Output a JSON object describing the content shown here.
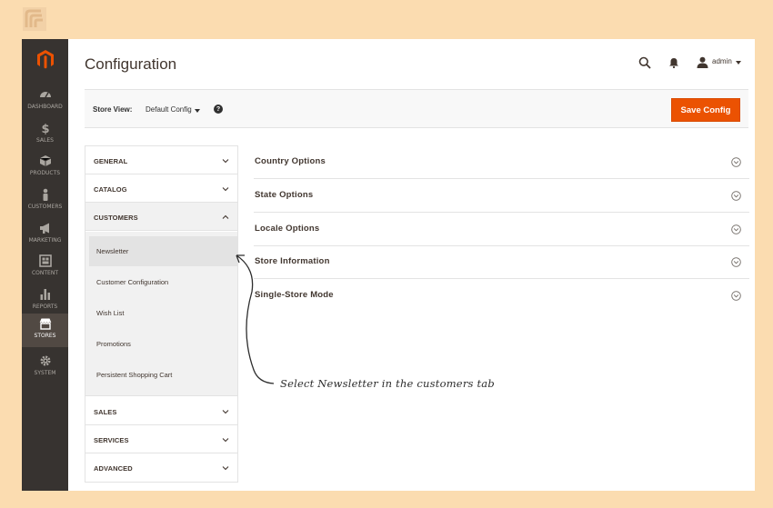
{
  "header": {
    "title": "Configuration",
    "user_name": "admin"
  },
  "nav": {
    "items": [
      {
        "label": "DASHBOARD",
        "icon": "dashboard-icon",
        "active": false
      },
      {
        "label": "SALES",
        "icon": "dollar-icon",
        "active": false
      },
      {
        "label": "PRODUCTS",
        "icon": "cube-icon",
        "active": false
      },
      {
        "label": "CUSTOMERS",
        "icon": "person-icon",
        "active": false
      },
      {
        "label": "MARKETING",
        "icon": "megaphone-icon",
        "active": false
      },
      {
        "label": "CONTENT",
        "icon": "content-icon",
        "active": false
      },
      {
        "label": "REPORTS",
        "icon": "bar-chart-icon",
        "active": false
      },
      {
        "label": "STORES",
        "icon": "store-icon",
        "active": true
      },
      {
        "label": "SYSTEM",
        "icon": "gear-icon",
        "active": false
      }
    ]
  },
  "store_bar": {
    "label": "Store View:",
    "value": "Default Config",
    "help": "?",
    "save_label": "Save Config"
  },
  "tabs": {
    "general": "GENERAL",
    "catalog": "CATALOG",
    "customers": "CUSTOMERS",
    "customers_items": [
      "Newsletter",
      "Customer Configuration",
      "Wish List",
      "Promotions",
      "Persistent Shopping Cart"
    ],
    "sales": "SALES",
    "services": "SERVICES",
    "advanced": "ADVANCED"
  },
  "sections": [
    "Country Options",
    "State Options",
    "Locale Options",
    "Store Information",
    "Single-Store Mode"
  ],
  "annotation": "Select Newsletter in the customers tab",
  "colors": {
    "background": "#fbdcb0",
    "nav": "#373330",
    "accent": "#eb5202",
    "text": "#41362f"
  }
}
